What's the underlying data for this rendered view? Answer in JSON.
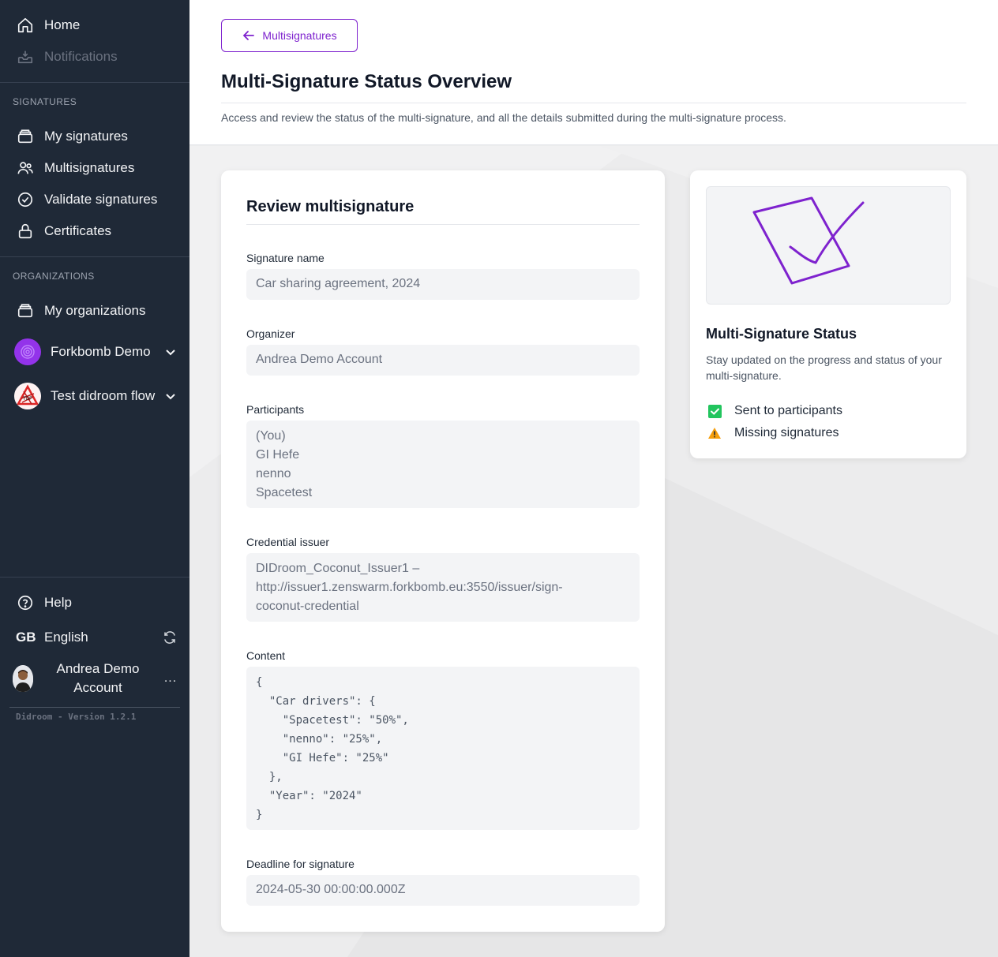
{
  "sidebar": {
    "home_label": "Home",
    "notifications_label": "Notifications",
    "signatures_section": "SIGNATURES",
    "my_signatures_label": "My signatures",
    "multisignatures_label": "Multisignatures",
    "validate_label": "Validate signatures",
    "certificates_label": "Certificates",
    "organizations_section": "ORGANIZATIONS",
    "my_organizations_label": "My organizations",
    "org_1_label": "Forkbomb Demo",
    "org_2_label": "Test didroom flow",
    "help_label": "Help",
    "lang_code": "GB",
    "lang_label": "English",
    "user_name": "Andrea Demo Account",
    "more_label": "...",
    "version": "Didroom - Version 1.2.1"
  },
  "header": {
    "back_label": "Multisignatures",
    "title": "Multi-Signature Status Overview",
    "description": "Access and review the status of the multi-signature, and all the details submitted during the multi-signature process."
  },
  "review": {
    "title": "Review multisignature",
    "signature_name_label": "Signature name",
    "signature_name": "Car sharing agreement, 2024",
    "organizer_label": "Organizer",
    "organizer": "Andrea Demo Account",
    "participants_label": "Participants",
    "participants": [
      "(You)",
      "GI Hefe",
      "nenno",
      "Spacetest"
    ],
    "issuer_label": "Credential issuer",
    "issuer": "DIDroom_Coconut_Issuer1 – http://issuer1.zenswarm.forkbomb.eu:3550/issuer/sign-coconut-credential",
    "content_label": "Content",
    "content": "{\n  \"Car drivers\": {\n    \"Spacetest\": \"50%\",\n    \"nenno\": \"25%\",\n    \"GI Hefe\": \"25%\"\n  },\n  \"Year\": \"2024\"\n}",
    "deadline_label": "Deadline for signature",
    "deadline": "2024-05-30 00:00:00.000Z"
  },
  "status": {
    "title": "Multi-Signature Status",
    "description": "Stay updated on the progress and status of your multi-signature.",
    "items": [
      {
        "label": "Sent to participants",
        "icon": "check-square-icon",
        "color": "#22c55e"
      },
      {
        "label": "Missing signatures",
        "icon": "warning-icon",
        "color": "#f59e0b"
      }
    ]
  },
  "colors": {
    "sidebar_bg": "#1f2937",
    "accent": "#7e22ce"
  }
}
